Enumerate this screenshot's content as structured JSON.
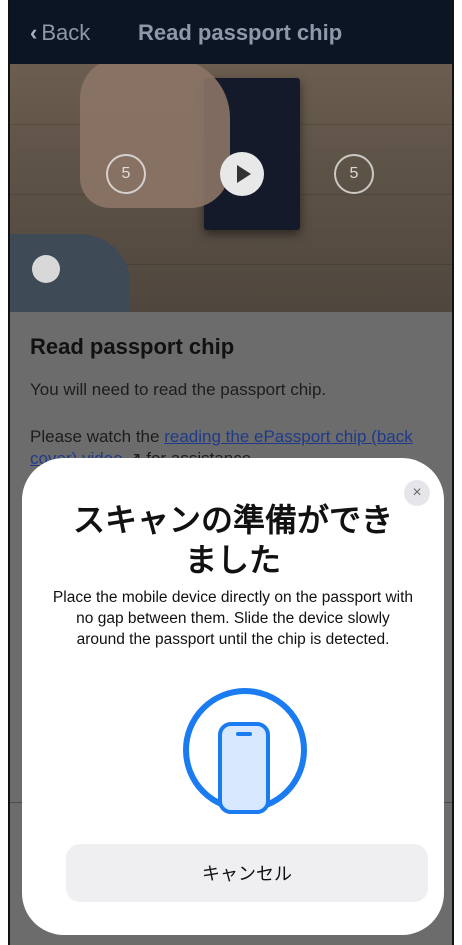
{
  "nav": {
    "back_label": "Back",
    "title": "Read passport chip"
  },
  "video": {
    "rewind_seconds": "5",
    "forward_seconds": "5"
  },
  "content": {
    "heading": "Read passport chip",
    "paragraph1": "You will need to read the passport chip.",
    "paragraph2_prefix": "Please watch the ",
    "link_text": "reading the ePassport chip (back cover) video",
    "paragraph2_suffix": " for assistance."
  },
  "sheet": {
    "title_line1": "スキャンの準備ができ",
    "title_line2": "ました",
    "description": "Place the mobile device directly on the passport with no gap between them. Slide the device slowly around the passport until the chip is detected.",
    "cancel_label": "キャンセル",
    "close_glyph": "×"
  },
  "colors": {
    "accent": "#1a7cf0",
    "navbar_bg": "#0c1524"
  },
  "icons": [
    "chevron-left-icon",
    "rewind-5-icon",
    "play-icon",
    "forward-5-icon",
    "close-icon",
    "phone-icon",
    "external-link-icon"
  ]
}
